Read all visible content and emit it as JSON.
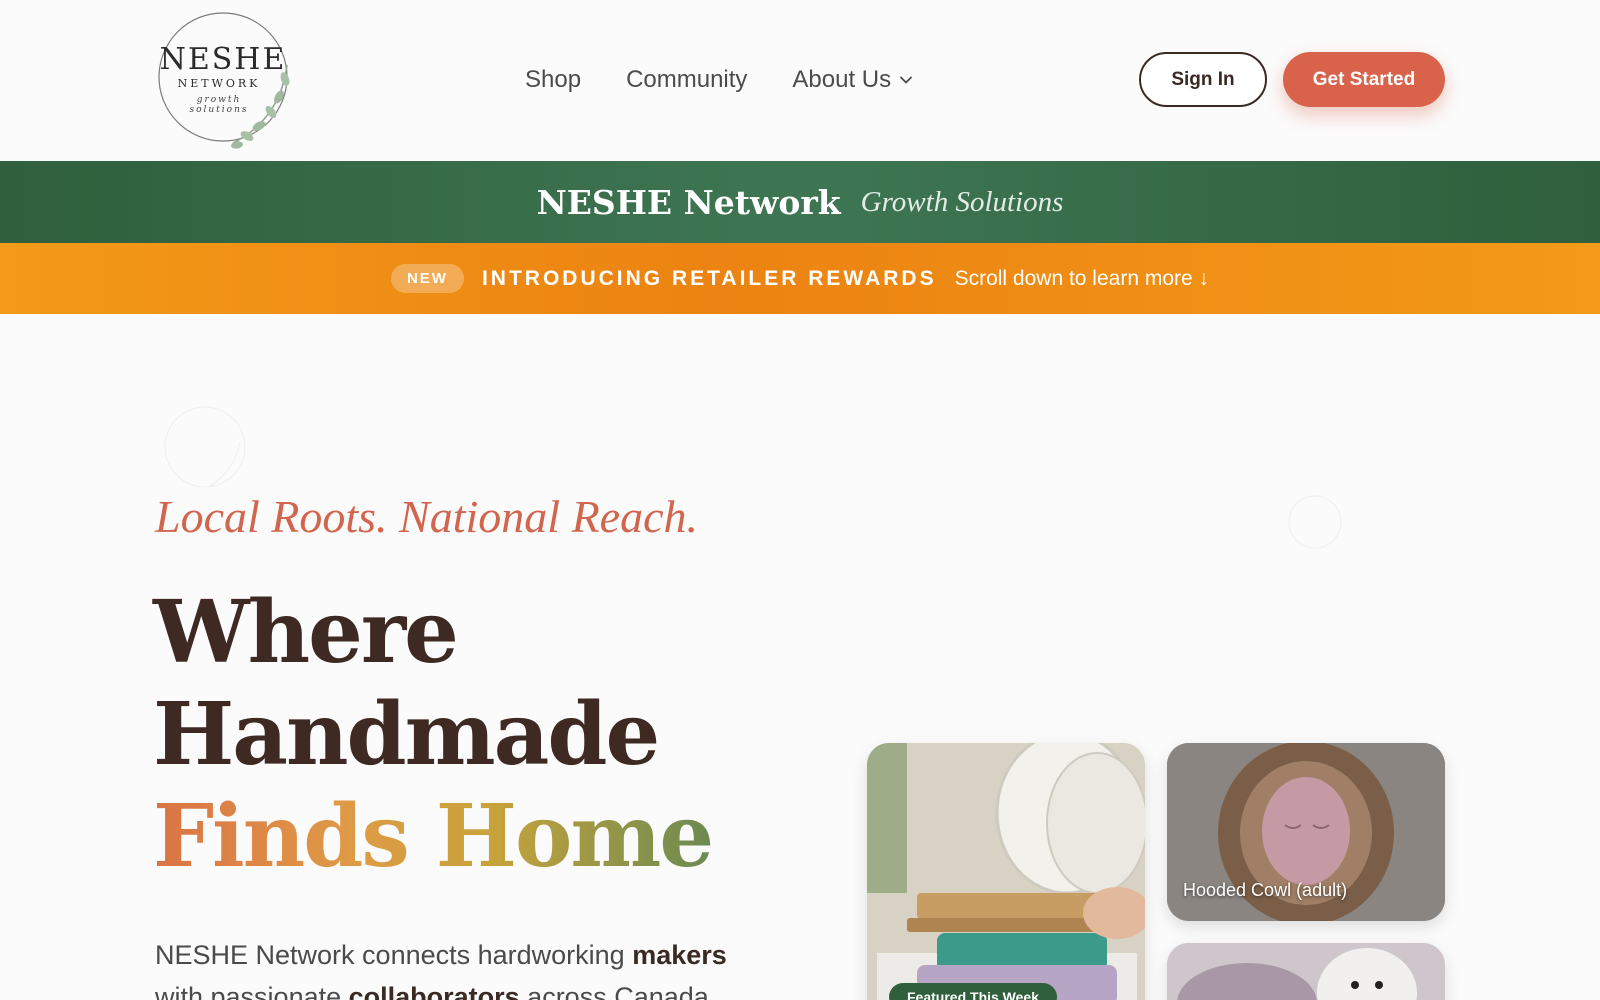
{
  "brand": {
    "logo_text": "NESHE",
    "logo_sub": "NETWORK",
    "logo_tagline_1": "growth",
    "logo_tagline_2": "solutions"
  },
  "nav": {
    "items": [
      {
        "label": "Shop"
      },
      {
        "label": "Community"
      },
      {
        "label": "About Us",
        "icon": "chevron-down-icon"
      }
    ]
  },
  "header": {
    "signin_label": "Sign In",
    "get_started_label": "Get Started"
  },
  "green_banner": {
    "title": "NESHE Network",
    "subtitle": "Growth Solutions"
  },
  "announcement": {
    "badge": "NEW",
    "title": "INTRODUCING RETAILER REWARDS",
    "link": "Scroll down to learn more ↓"
  },
  "hero": {
    "tagline": "Local Roots. National Reach.",
    "headline_line1": "Where",
    "headline_line2": "Handmade",
    "headline_line3": "Finds Home",
    "body_prefix": "NESHE Network connects hardworking ",
    "body_bold1": "makers",
    "body_mid": " with passionate ",
    "body_bold2": "collaborators",
    "body_suffix": " across Canada."
  },
  "cards": {
    "card1_pill": "Featured This Week",
    "card2_caption": "Hooded Cowl (adult)"
  },
  "colors": {
    "accent": "#d9634a",
    "green": "#2f5f3c",
    "orange": "#ec8312",
    "heading": "#3e2a22"
  }
}
